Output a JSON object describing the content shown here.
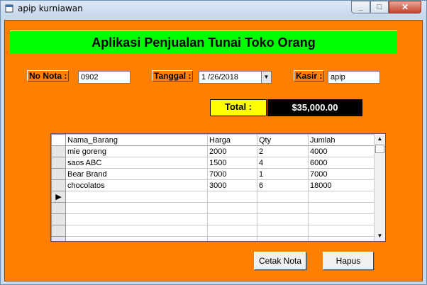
{
  "window": {
    "title": "apip kurniawan",
    "minimize_icon": "minimize-icon",
    "maximize_icon": "maximize-icon",
    "close_icon": "close-icon"
  },
  "banner": {
    "text": "Aplikasi Penjualan Tunai Toko Orang",
    "color": "#00ff00"
  },
  "form": {
    "no_nota_label": "No Nota :",
    "no_nota_value": "0902",
    "tanggal_label": "Tanggal :",
    "tanggal_value": "1 /26/2018",
    "kasir_label": "Kasir :",
    "kasir_value": "apip"
  },
  "total": {
    "label": "Total :",
    "value": "$35,000.00"
  },
  "grid": {
    "columns": [
      "Nama_Barang",
      "Harga",
      "Qty",
      "Jumlah"
    ],
    "rows": [
      [
        "mie goreng",
        "2000",
        "2",
        "4000"
      ],
      [
        "saos ABC",
        "1500",
        "4",
        "6000"
      ],
      [
        "Bear Brand",
        "7000",
        "1",
        "7000"
      ],
      [
        "chocolatos",
        "3000",
        "6",
        "18000"
      ]
    ]
  },
  "buttons": {
    "print": "Cetak Nota",
    "delete": "Hapus"
  },
  "colors": {
    "background": "#ff8000",
    "total_label": "#ffff00",
    "total_value": "#000000"
  }
}
